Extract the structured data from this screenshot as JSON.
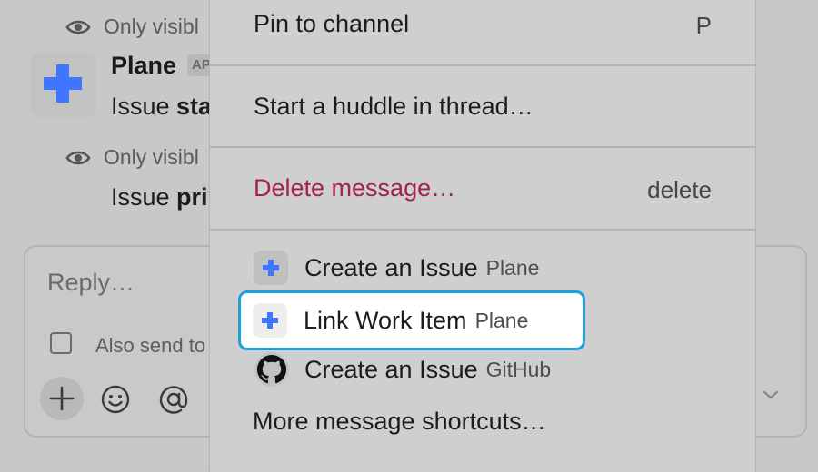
{
  "thread": {
    "ephemeral_1": "Only visibl",
    "sender": "Plane",
    "app_tag": "AP",
    "message_1_prefix": "Issue ",
    "message_1_bold": "sta",
    "ephemeral_2": "Only visibl",
    "message_2_prefix": "Issue ",
    "message_2_bold": "pri"
  },
  "composer": {
    "placeholder": "Reply…",
    "also_send_label": "Also send to"
  },
  "menu": {
    "pin": {
      "label": "Pin to channel",
      "shortcut": "P"
    },
    "huddle": {
      "label": "Start a huddle in thread…"
    },
    "delete": {
      "label": "Delete message…",
      "shortcut": "delete"
    },
    "shortcuts": [
      {
        "label": "Create an Issue",
        "source": "Plane",
        "icon": "plane-icon"
      },
      {
        "label": "Link Work Item",
        "source": "Plane",
        "icon": "plane-icon",
        "highlighted": true
      },
      {
        "label": "Create an Issue",
        "source": "GitHub",
        "icon": "github-icon"
      }
    ],
    "more": "More message shortcuts…"
  },
  "colors": {
    "plane_blue": "#3f76ff",
    "danger": "#a3214a",
    "focus_ring": "#1da1d8"
  }
}
